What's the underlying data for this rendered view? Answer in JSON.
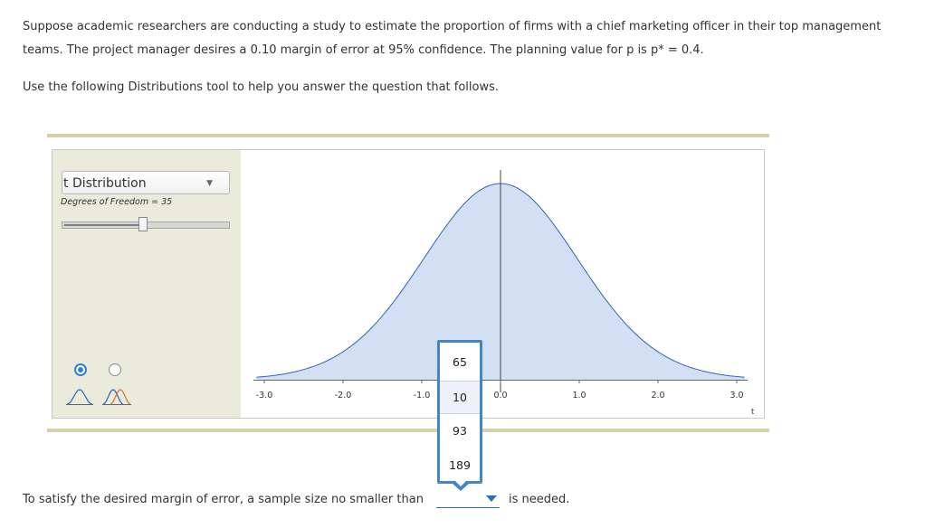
{
  "question": {
    "paragraph1": "Suppose academic researchers are conducting a study to estimate the proportion of firms with a chief marketing officer in their top management teams. The project manager desires a 0.10 margin of error at 95% confidence. The planning value for p is p* = 0.4.",
    "paragraph2": "Use the following Distributions tool to help you answer the question that follows."
  },
  "tool": {
    "distribution_select": "t Distribution",
    "df_label": "Degrees of Freedom = 35",
    "df_slider_fraction": 0.48,
    "mode_selected": 1,
    "curve_fill": "#d3dff3",
    "curve_stroke": "#2e63b8",
    "x_ticks": [
      "-3.0",
      "-2.0",
      "-1.0",
      "0.0",
      "1.0",
      "2.0",
      "3.0"
    ],
    "x_axis_label": "t"
  },
  "answer": {
    "lead_text": "To satisfy the desired margin of error, a sample size no smaller than",
    "trail_text": "is needed.",
    "selected_value": "",
    "options": [
      "65",
      "10",
      "93",
      "189"
    ],
    "highlighted_option": "10"
  }
}
